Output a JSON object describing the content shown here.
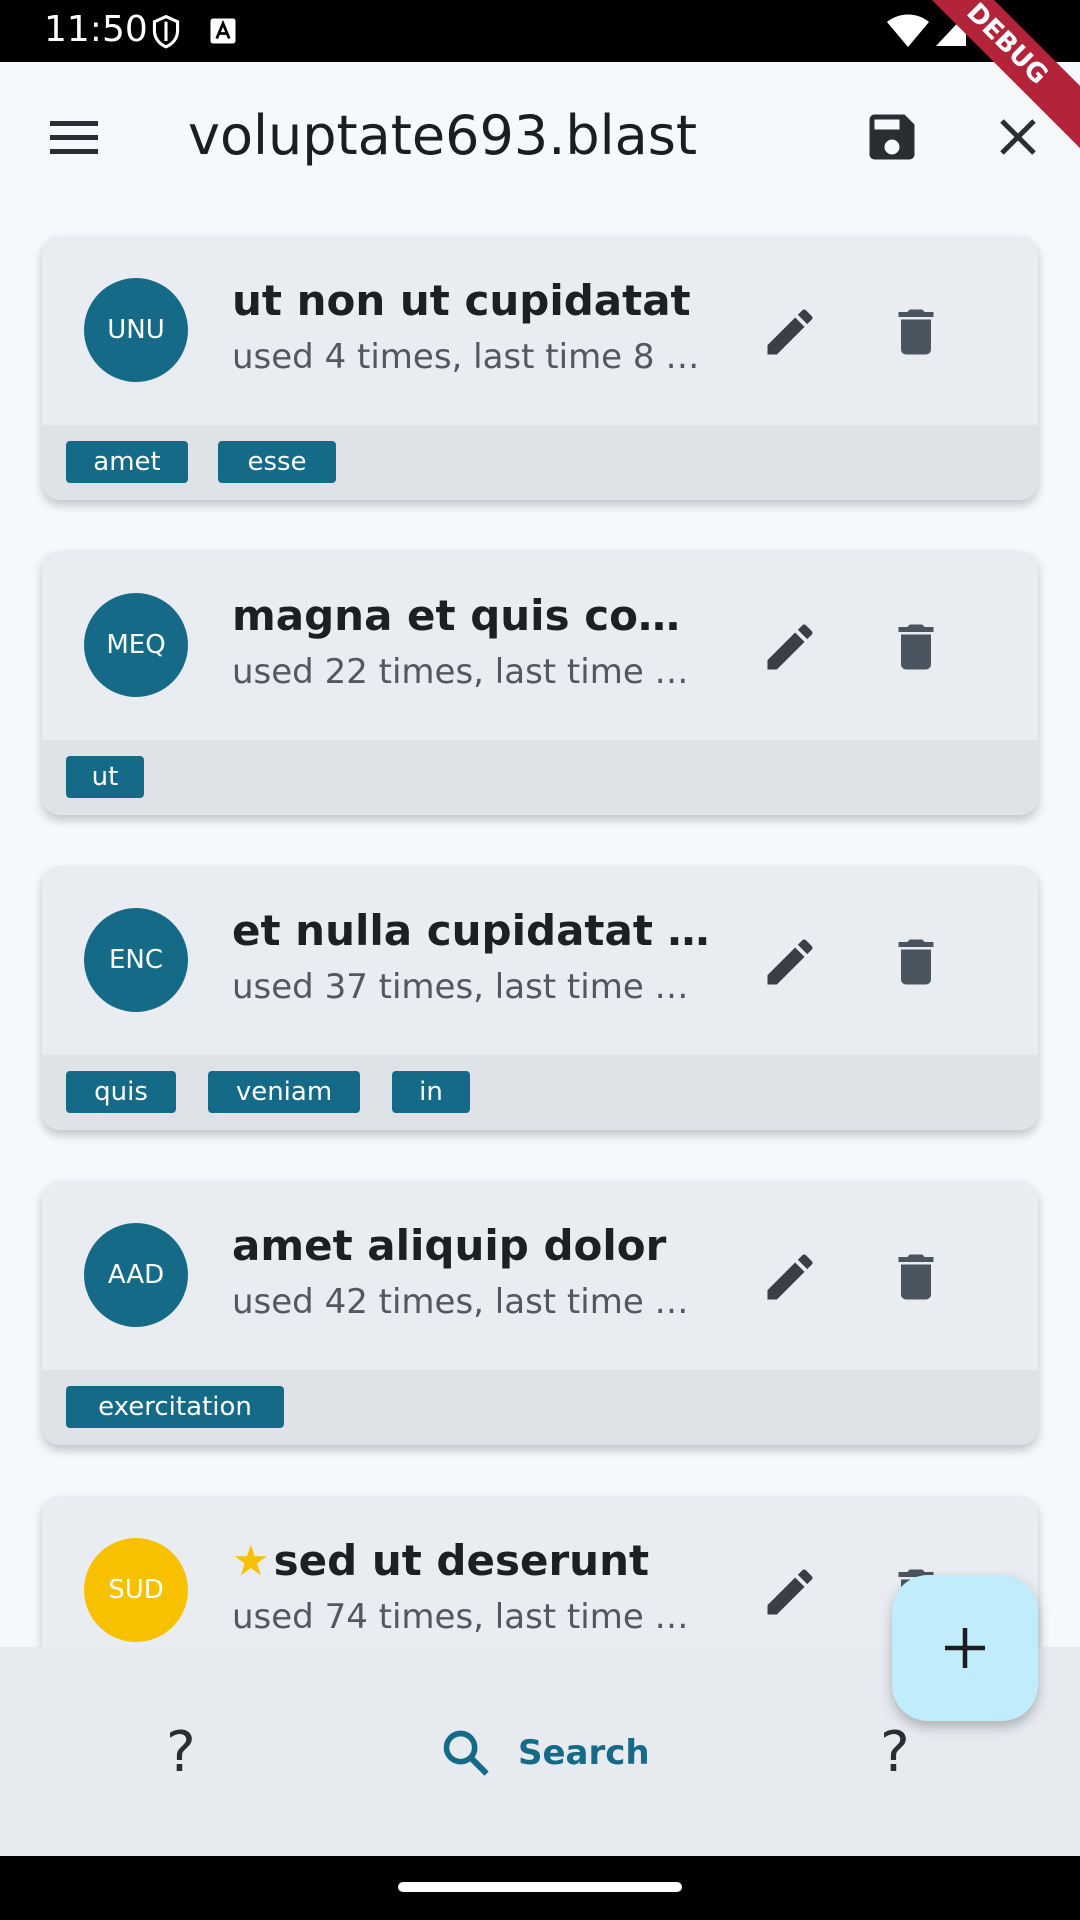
{
  "status_bar": {
    "time": "11:50"
  },
  "debug_banner": "DEBUG",
  "app_bar": {
    "title": "voluptate693.blast"
  },
  "items": [
    {
      "initials": "UNU",
      "avatar_color": "#156a87",
      "starred": false,
      "title": "ut non ut cupidatat",
      "subtitle": "used 4 times, last time 8 …",
      "tags": [
        "amet",
        "esse"
      ]
    },
    {
      "initials": "MEQ",
      "avatar_color": "#156a87",
      "starred": false,
      "title": "magna et quis com…",
      "subtitle": "used 22 times, last time …",
      "tags": [
        "ut"
      ]
    },
    {
      "initials": "ENC",
      "avatar_color": "#156a87",
      "starred": false,
      "title": "et nulla cupidatat de…",
      "subtitle": "used 37 times, last time …",
      "tags": [
        "quis",
        "veniam",
        "in"
      ]
    },
    {
      "initials": "AAD",
      "avatar_color": "#156a87",
      "starred": false,
      "title": "amet aliquip dolor",
      "subtitle": "used 42 times, last time …",
      "tags": [
        "exercitation"
      ]
    },
    {
      "initials": "SUD",
      "avatar_color": "#f7c100",
      "starred": true,
      "title": "sed ut deserunt",
      "subtitle": "used 74 times, last time …",
      "tags": []
    }
  ],
  "bottom_nav": {
    "left_label": "?",
    "search_label": "Search",
    "right_label": "?"
  },
  "colors": {
    "accent": "#156a87",
    "star": "#f7c100",
    "fab": "#c0ecfb"
  }
}
